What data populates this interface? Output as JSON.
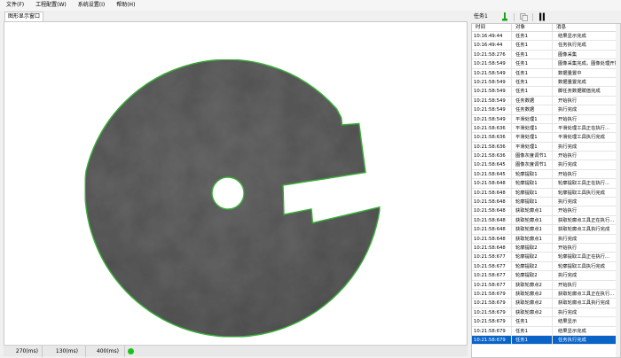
{
  "menu": [
    "文件(F)",
    "工程配置(W)",
    "系统设置(I)",
    "帮助(H)"
  ],
  "display": {
    "tab_label": "图形显示窗口"
  },
  "status": {
    "t1": "270(ms)",
    "t2": "130(ms)",
    "t3": "400(ms)",
    "indicator_color": "#18c218"
  },
  "task_panel": {
    "task_label": "任务1",
    "run_icon": "run-icon",
    "copy_icon": "copy-icon",
    "pause_icon": "pause-icon"
  },
  "log": {
    "headers": [
      "时间",
      "对象",
      "消息"
    ],
    "rows": [
      [
        "10:16:49:44",
        "任务1",
        "结果显示完成"
      ],
      [
        "10:16:49:44",
        "任务1",
        "任务执行完成"
      ],
      [
        "10:21:58:276",
        "任务1",
        "图像采集"
      ],
      [
        "10:21:58:549",
        "任务1",
        "图像采集完成，图像处理开始"
      ],
      [
        "10:21:58:549",
        "任务1",
        "数据量置中"
      ],
      [
        "10:21:58:549",
        "任务1",
        "数据量置完成"
      ],
      [
        "10:21:58:549",
        "任务1",
        "脚任务数据赋值完成"
      ],
      [
        "10:21:58:549",
        "任务数据",
        "开始执行"
      ],
      [
        "10:21:58:549",
        "任务数据",
        "执行完成"
      ],
      [
        "10:21:58:549",
        "平滑处理1",
        "开始执行"
      ],
      [
        "10:21:58:636",
        "平滑处理1",
        "平滑处理工具正在执行..."
      ],
      [
        "10:21:58:636",
        "平滑处理1",
        "平滑处理工具执行完成"
      ],
      [
        "10:21:58:636",
        "平滑处理1",
        "执行完成"
      ],
      [
        "10:21:58:636",
        "图像灰度调节1",
        "开始执行"
      ],
      [
        "10:21:58:645",
        "图像灰度调节1",
        "执行完成"
      ],
      [
        "10:21:58:645",
        "轮廓提取1",
        "开始执行"
      ],
      [
        "10:21:58:648",
        "轮廓提取1",
        "轮廓提取工具正在执行..."
      ],
      [
        "10:21:58:648",
        "轮廓提取1",
        "轮廓提取工具执行完成"
      ],
      [
        "10:21:58:648",
        "轮廓提取1",
        "执行完成"
      ],
      [
        "10:21:58:648",
        "获取轮廓点1",
        "开始执行"
      ],
      [
        "10:21:58:648",
        "获取轮廓点1",
        "获取轮廓点工具正在执行..."
      ],
      [
        "10:21:58:648",
        "获取轮廓点1",
        "获取轮廓点工具执行完成"
      ],
      [
        "10:21:58:648",
        "获取轮廓点1",
        "执行完成"
      ],
      [
        "10:21:58:648",
        "轮廓提取2",
        "开始执行"
      ],
      [
        "10:21:58:677",
        "轮廓提取2",
        "轮廓提取工具正在执行..."
      ],
      [
        "10:21:58:677",
        "轮廓提取2",
        "轮廓提取工具执行完成"
      ],
      [
        "10:21:58:677",
        "轮廓提取2",
        "执行完成"
      ],
      [
        "10:21:58:677",
        "获取轮廓点2",
        "开始执行"
      ],
      [
        "10:21:58:679",
        "获取轮廓点2",
        "获取轮廓点工具正在执行..."
      ],
      [
        "10:21:58:679",
        "获取轮廓点2",
        "获取轮廓点工具执行完成"
      ],
      [
        "10:21:58:679",
        "获取轮廓点2",
        "执行完成"
      ],
      [
        "10:21:58:679",
        "任务1",
        "结果显示"
      ],
      [
        "10:21:58:679",
        "任务1",
        "结果显示完成"
      ],
      [
        "10:21:58:679",
        "任务1",
        "任务执行完成"
      ]
    ],
    "selected_index": 33
  }
}
